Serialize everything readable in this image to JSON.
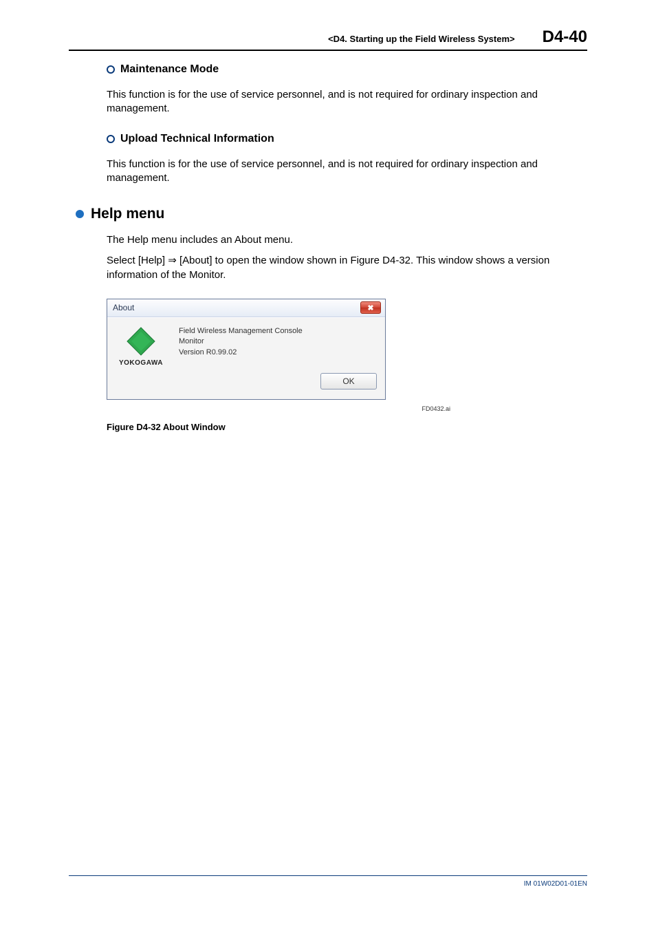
{
  "header": {
    "breadcrumb": "<D4.  Starting up the Field Wireless System>",
    "page_number": "D4-40"
  },
  "sections": {
    "maintenance": {
      "title": "Maintenance Mode",
      "body": "This function is for the use of service personnel, and is not required for ordinary inspection and management."
    },
    "upload": {
      "title": "Upload Technical Information",
      "body": "This function is for the use of service personnel, and is not required for ordinary inspection and management."
    },
    "help": {
      "title": "Help menu",
      "intro": "The Help menu includes an About menu.",
      "instruction_pre": "Select [Help] ",
      "arrow": "⇒",
      "instruction_post": " [About] to open the window shown in Figure D4-32. This window shows a version information of the Monitor."
    }
  },
  "dialog": {
    "title": "About",
    "close_glyph": "✖",
    "logo_brand": "YOKOGAWA",
    "line1": "Field Wireless Management Console",
    "line2": "Monitor",
    "line3": "Version R0.99.02",
    "ok_label": "OK"
  },
  "figure": {
    "ref": "FD0432.ai",
    "caption": "Figure D4-32  About Window"
  },
  "footer": {
    "doc_id": "IM 01W02D01-01EN"
  }
}
